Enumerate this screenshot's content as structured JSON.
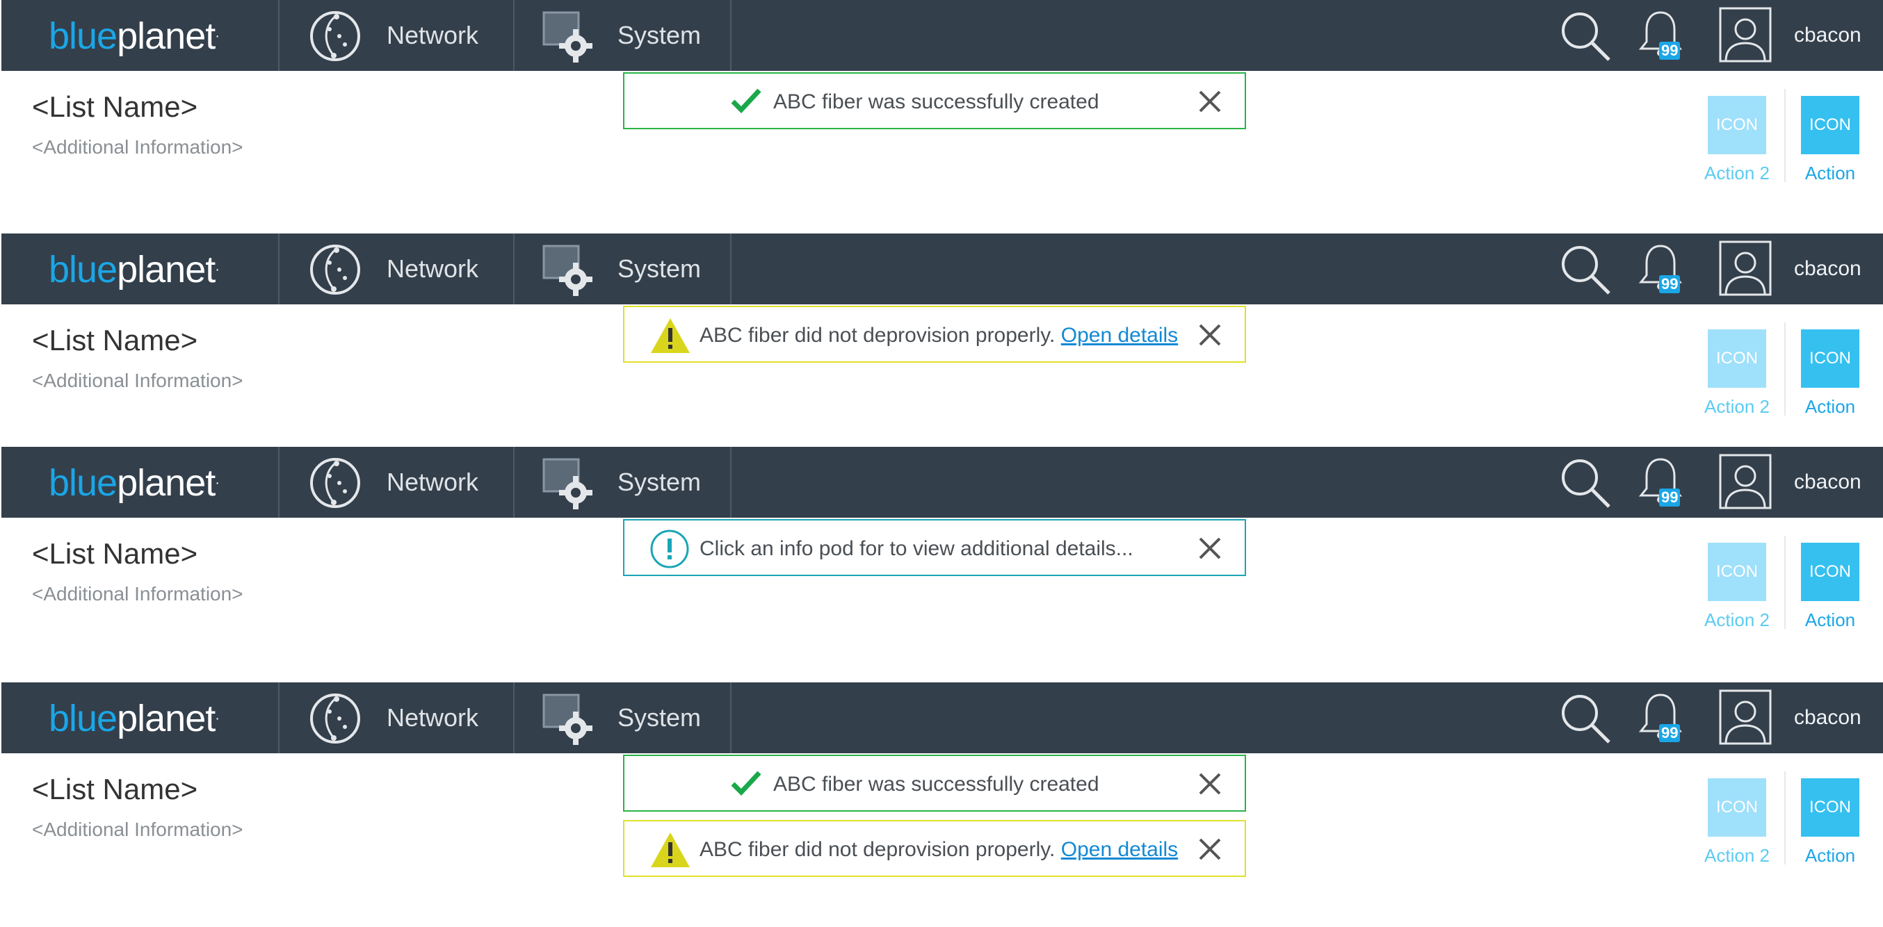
{
  "colors": {
    "nav_bg": "#333f4b",
    "brand_blue": "#1ba6e6",
    "success": "#28b446",
    "warning": "#e0e02a",
    "info": "#19a5b5",
    "link": "#1289d3"
  },
  "header": {
    "logo_part1": "blue",
    "logo_part2": "planet",
    "nav": [
      {
        "label": "Network",
        "icon": "network-icon"
      },
      {
        "label": "System",
        "icon": "system-settings-icon"
      }
    ],
    "search_icon": "search-icon",
    "notification_icon": "bell-icon",
    "notification_count": "99",
    "user_icon": "user-avatar-icon",
    "username": "cbacon"
  },
  "content": {
    "list_name": "<List Name>",
    "additional_info": "<Additional Information>",
    "action2_icon_text": "ICON",
    "action2_label": "Action 2",
    "action1_icon_text": "ICON",
    "action1_label": "Action"
  },
  "toasts": {
    "success": {
      "message": "ABC fiber was successfully created",
      "icon": "checkmark-icon"
    },
    "warning": {
      "message": "ABC fiber did not deprovision properly.",
      "link": "Open details",
      "icon": "warning-triangle-icon"
    },
    "info": {
      "message": "Click an info pod for to view additional details...",
      "icon": "info-circle-icon"
    },
    "close_icon": "close-icon"
  }
}
